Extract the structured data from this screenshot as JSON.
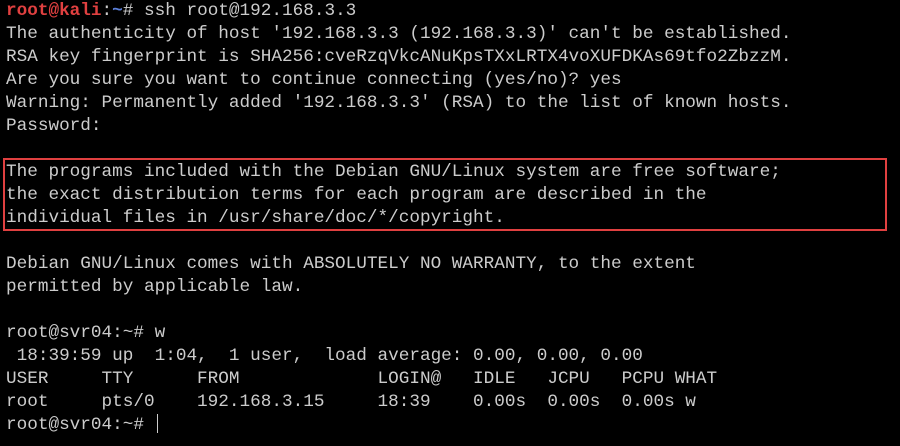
{
  "terminal": {
    "prompt_line": {
      "user_host": "root@kali",
      "colon": ":",
      "path": "~",
      "symbol": "# ",
      "command": "ssh root@192.168.3.3"
    },
    "ssh_output": [
      "The authenticity of host '192.168.3.3 (192.168.3.3)' can't be established.",
      "RSA key fingerprint is SHA256:cveRzqVkcANuKpsTXxLRTX4voXUFDKAs69tfo2ZbzzM.",
      "Are you sure you want to continue connecting (yes/no)? yes",
      "Warning: Permanently added '192.168.3.3' (RSA) to the list of known hosts.",
      "Password:"
    ],
    "motd_highlighted": [
      "The programs included with the Debian GNU/Linux system are free software;",
      "the exact distribution terms for each program are described in the",
      "individual files in /usr/share/doc/*/copyright."
    ],
    "warranty": [
      "Debian GNU/Linux comes with ABSOLUTELY NO WARRANTY, to the extent",
      "permitted by applicable law."
    ],
    "w_command": "root@svr04:~# w",
    "w_uptime": " 18:39:59 up  1:04,  1 user,  load average: 0.00, 0.00, 0.00",
    "w_header": "USER     TTY      FROM             LOGIN@   IDLE   JCPU   PCPU WHAT",
    "w_row": "root     pts/0    192.168.3.15     18:39    0.00s  0.00s  0.00s w",
    "final_prompt": "root@svr04:~# "
  },
  "colors": {
    "background": "#000000",
    "text": "#cccccc",
    "kali_user": "#e04040",
    "kali_path": "#5b7fd8",
    "highlight_border": "#e04040"
  }
}
